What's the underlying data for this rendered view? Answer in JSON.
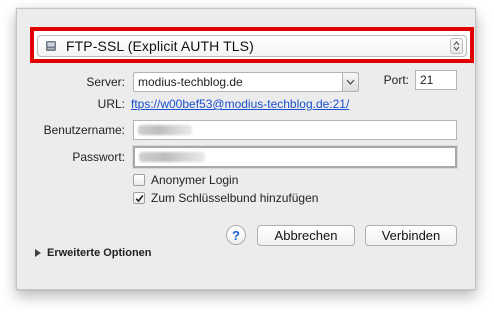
{
  "protocol": {
    "selected": "FTP-SSL (Explicit AUTH TLS)",
    "icon": "drive-icon"
  },
  "server": {
    "label": "Server:",
    "value": "modius-techblog.de"
  },
  "port": {
    "label": "Port:",
    "value": "21"
  },
  "url": {
    "label": "URL:",
    "value": "ftps://w00bef53@modius-techblog.de:21/"
  },
  "username": {
    "label": "Benutzername:",
    "value": ""
  },
  "password": {
    "label": "Passwort:",
    "value": ""
  },
  "options": {
    "anonymous": {
      "label": "Anonymer Login",
      "checked": false
    },
    "keychain": {
      "label": "Zum Schlüsselbund hinzufügen",
      "checked": true
    }
  },
  "buttons": {
    "help": "?",
    "cancel": "Abbrechen",
    "connect": "Verbinden"
  },
  "advanced": {
    "label": "Erweiterte Optionen"
  },
  "colors": {
    "highlight": "#e00000",
    "link": "#1a4fd0"
  }
}
